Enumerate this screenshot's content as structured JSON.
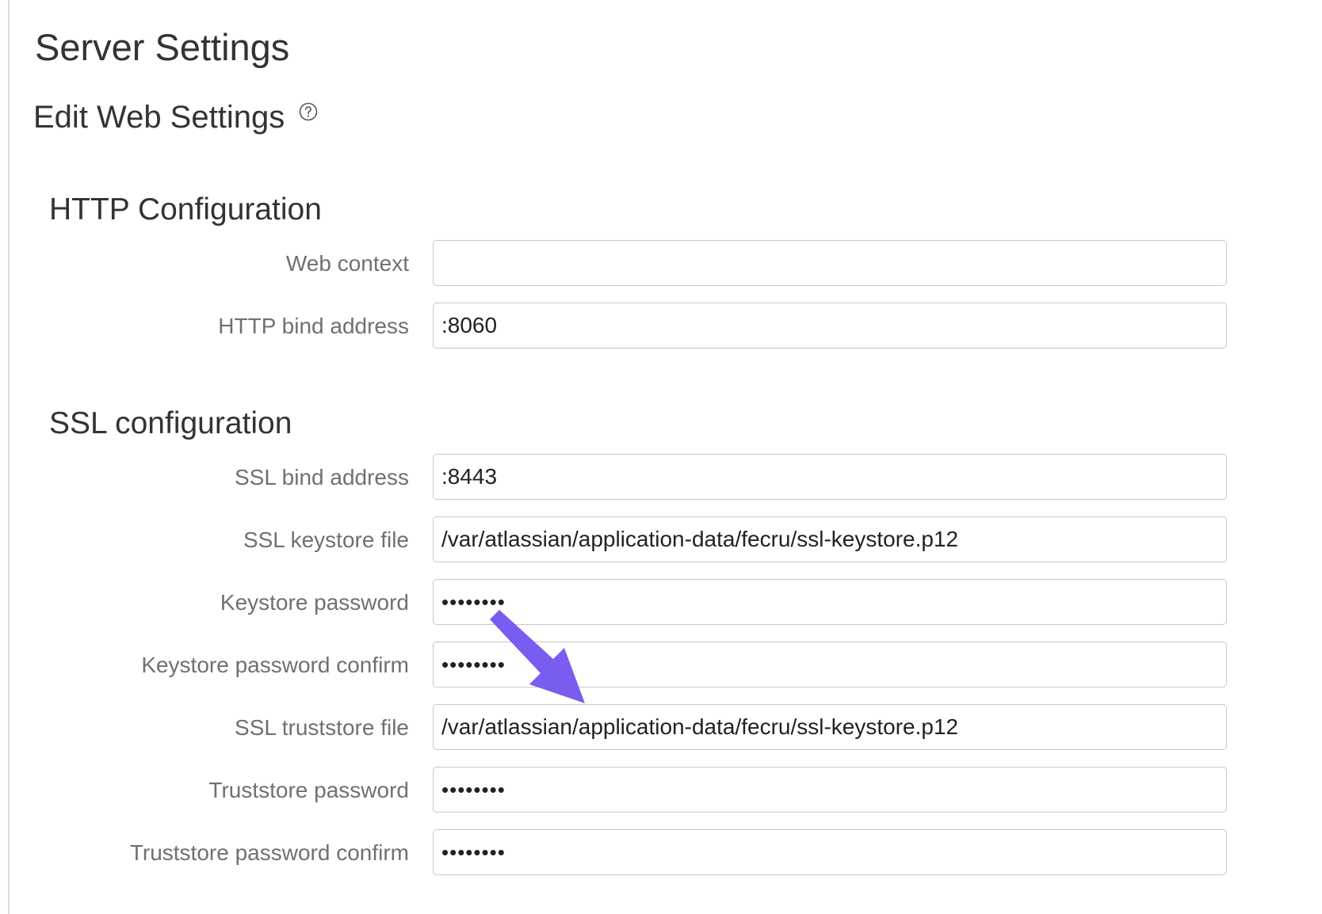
{
  "header": {
    "title": "Server Settings",
    "subtitle": "Edit Web Settings"
  },
  "icons": {
    "help": "help-circle-icon",
    "annotation": "arrow-annotation-icon"
  },
  "colors": {
    "arrow": "#7b5cf0",
    "label": "#707070",
    "text": "#333333",
    "input_border": "#c8c8c8"
  },
  "http": {
    "title": "HTTP Configuration",
    "web_context": {
      "label": "Web context",
      "value": ""
    },
    "http_bind_address": {
      "label": "HTTP bind address",
      "value": ":8060"
    }
  },
  "ssl": {
    "title": "SSL configuration",
    "ssl_bind_address": {
      "label": "SSL bind address",
      "value": ":8443"
    },
    "ssl_keystore_file": {
      "label": "SSL keystore file",
      "value": "/var/atlassian/application-data/fecru/ssl-keystore.p12"
    },
    "keystore_password": {
      "label": "Keystore password",
      "value": "••••••••"
    },
    "keystore_password_confirm": {
      "label": "Keystore password confirm",
      "value": "••••••••"
    },
    "ssl_truststore_file": {
      "label": "SSL truststore file",
      "value": "/var/atlassian/application-data/fecru/ssl-keystore.p12"
    },
    "truststore_password": {
      "label": "Truststore password",
      "value": "••••••••"
    },
    "truststore_password_confirm": {
      "label": "Truststore password confirm",
      "value": "••••••••"
    }
  }
}
